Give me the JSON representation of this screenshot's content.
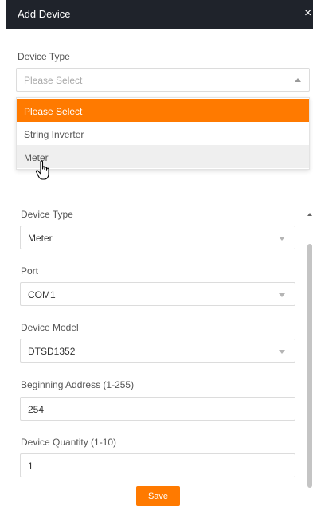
{
  "dialog": {
    "title": "Add Device",
    "close_glyph": "×"
  },
  "top_form": {
    "device_type_label": "Device Type",
    "select_value": "Please Select",
    "dropdown_options": [
      "Please Select",
      "String Inverter",
      "Meter"
    ],
    "selected_option_index": 0,
    "hovered_option_index": 2
  },
  "meter_form": {
    "device_type_label": "Device Type",
    "device_type_value": "Meter",
    "port_label": "Port",
    "port_value": "COM1",
    "device_model_label": "Device Model",
    "device_model_value": "DTSD1352",
    "beginning_address_label": "Beginning Address (1-255)",
    "beginning_address_value": "254",
    "device_quantity_label": "Device Quantity (1-10)",
    "device_quantity_value": "1",
    "save_label": "Save"
  },
  "colors": {
    "accent": "#ff7a00",
    "titlebar": "#1f232b",
    "hover_row": "#efefef"
  },
  "icons": {
    "cursor": "hand-pointer-icon",
    "close": "close-icon"
  }
}
